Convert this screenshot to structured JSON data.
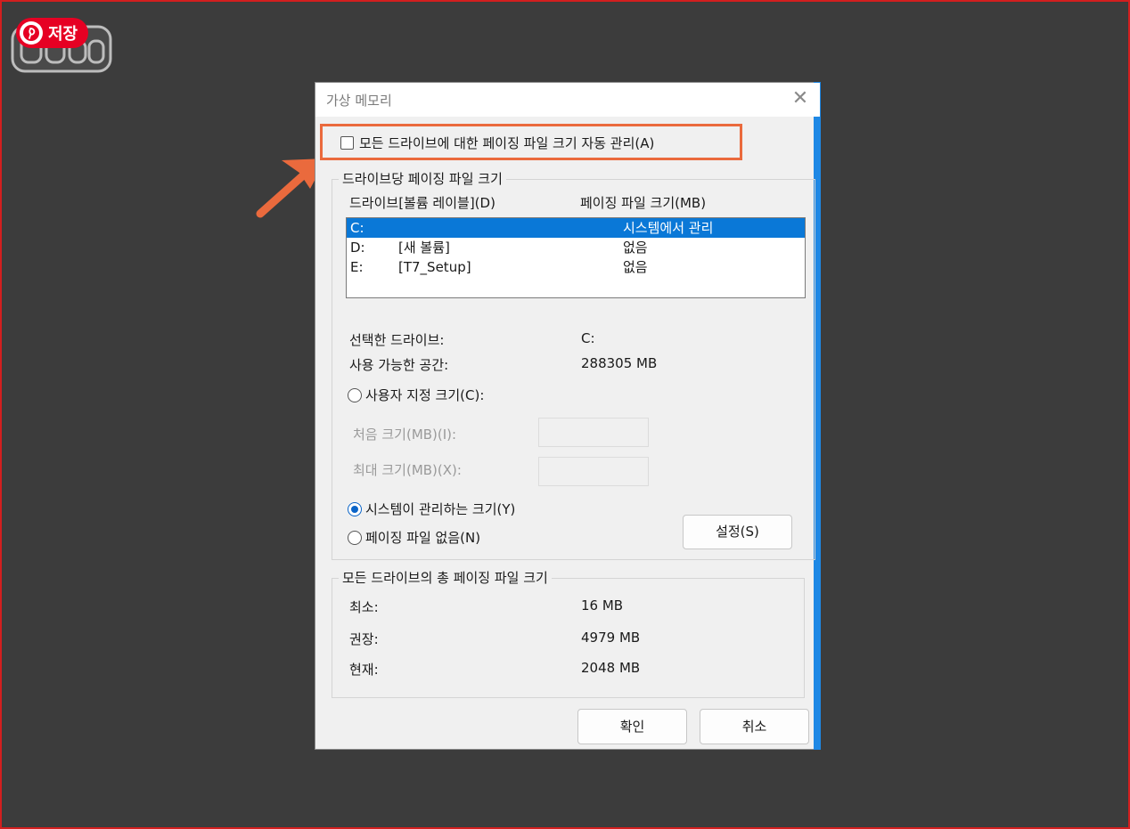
{
  "pin_badge": {
    "label": "저장"
  },
  "dialog": {
    "title": "가상 메모리",
    "auto_manage_label": "모든 드라이브에 대한 페이징 파일 크기 자동 관리(A)",
    "per_drive_group": {
      "legend": "드라이브당 페이징 파일 크기",
      "col_drive": "드라이브[볼륨 레이블](D)",
      "col_size": "페이징 파일 크기(MB)",
      "rows": [
        {
          "drive": "C:",
          "label": "",
          "size": "시스템에서 관리"
        },
        {
          "drive": "D:",
          "label": "[새 볼륨]",
          "size": "없음"
        },
        {
          "drive": "E:",
          "label": "[T7_Setup]",
          "size": "없음"
        }
      ],
      "selected_drive_label": "선택한 드라이브:",
      "selected_drive_value": "C:",
      "available_space_label": "사용 가능한 공간:",
      "available_space_value": "288305 MB",
      "custom_size_label": "사용자 지정 크기(C):",
      "initial_size_label": "처음 크기(MB)(I):",
      "max_size_label": "최대 크기(MB)(X):",
      "system_managed_label": "시스템이 관리하는 크기(Y)",
      "no_paging_label": "페이징 파일 없음(N)",
      "set_button": "설정(S)"
    },
    "total_group": {
      "legend": "모든 드라이브의 총 페이징 파일 크기",
      "min_label": "최소:",
      "min_value": "16 MB",
      "recommended_label": "권장:",
      "recommended_value": "4979 MB",
      "current_label": "현재:",
      "current_value": "2048 MB"
    },
    "ok_button": "확인",
    "cancel_button": "취소"
  },
  "colors": {
    "highlight": "#ea6a3d",
    "selection": "#0a78d7",
    "pinterest": "#e60023",
    "background": "#3c3c3c"
  }
}
